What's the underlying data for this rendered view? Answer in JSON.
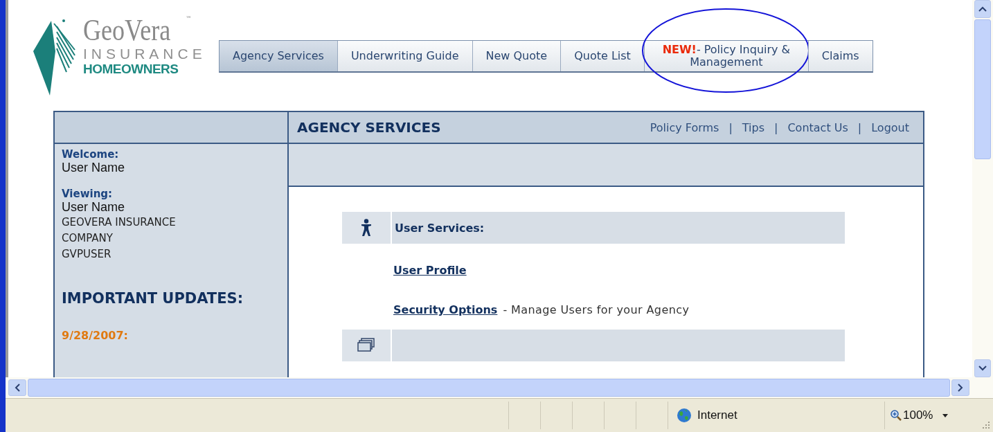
{
  "logo": {
    "brand": "GeoVera",
    "trademark": "™",
    "line_2": "INSURANCE",
    "line_3": "HOMEOWNERS"
  },
  "tabs": [
    {
      "label": "Agency Services",
      "selected": true
    },
    {
      "label": "Underwriting Guide",
      "selected": false
    },
    {
      "label": "New Quote",
      "selected": false
    },
    {
      "label": "Quote List",
      "selected": false
    },
    {
      "badge": "NEW!",
      "label": "- Policy Inquiry & Management",
      "selected": false,
      "circled": true
    },
    {
      "label": "Claims",
      "selected": false
    }
  ],
  "panel": {
    "title": "AGENCY SERVICES",
    "links": [
      "Policy Forms",
      "Tips",
      "Contact Us",
      "Logout"
    ],
    "separator": "|"
  },
  "sidebar": {
    "welcome_label": "Welcome:",
    "welcome_name": "User Name",
    "viewing_label": "Viewing:",
    "viewing_name": "User Name",
    "viewing_lines": [
      "GEOVERA INSURANCE",
      "COMPANY",
      "GVPUSER"
    ],
    "updates_title": "IMPORTANT UPDATES:",
    "update_date": "9/28/2007:"
  },
  "sections": [
    {
      "kind": "person",
      "title": "User Services:",
      "items": [
        {
          "link": "User Profile"
        },
        {
          "link": "Security Options",
          "note": "- Manage Users for your Agency"
        }
      ]
    },
    {
      "kind": "documents"
    }
  ],
  "status_bar": {
    "zone": "Internet",
    "zoom": "100%"
  }
}
